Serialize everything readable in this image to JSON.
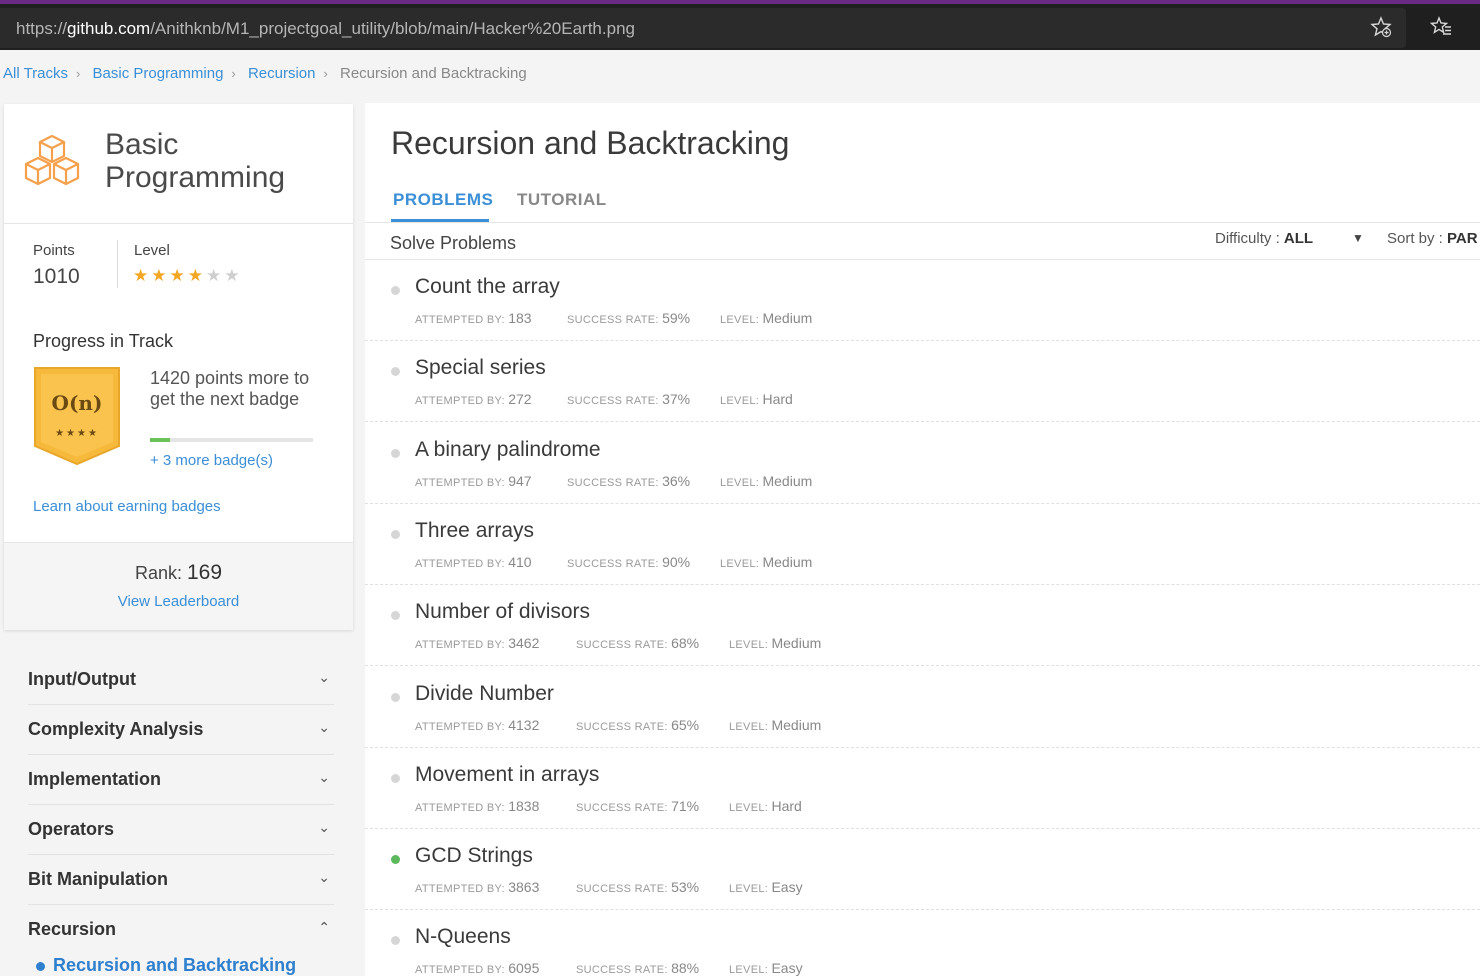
{
  "browser": {
    "url_prefix": "https://",
    "url_domain": "github.com",
    "url_path": "/Anithknb/M1_projectgoal_utility/blob/main/Hacker%20Earth.png"
  },
  "breadcrumb": [
    "All Tracks",
    "Basic Programming",
    "Recursion",
    "Recursion and Backtracking"
  ],
  "track": {
    "title": "Basic Programming",
    "points_label": "Points",
    "points": "1010",
    "level_label": "Level",
    "level_stars": 4,
    "level_max": 6,
    "progress_title": "Progress in Track",
    "badge_text": "O(n)",
    "badge_stars": "★★★★",
    "next_badge_text": "1420 points more to get the next badge",
    "progress_fraction": 0.12,
    "more_badges": "+ 3 more badge(s)",
    "learn_link": "Learn about earning badges",
    "rank_label": "Rank:",
    "rank": "169",
    "leaderboard_link": "View Leaderboard"
  },
  "nav": {
    "items": [
      {
        "label": "Input/Output",
        "expanded": false
      },
      {
        "label": "Complexity Analysis",
        "expanded": false
      },
      {
        "label": "Implementation",
        "expanded": false
      },
      {
        "label": "Operators",
        "expanded": false
      },
      {
        "label": "Bit Manipulation",
        "expanded": false
      },
      {
        "label": "Recursion",
        "expanded": true
      }
    ],
    "active_subitem": "Recursion and Backtracking"
  },
  "main": {
    "title": "Recursion and Backtracking",
    "tabs": [
      "PROBLEMS",
      "TUTORIAL"
    ],
    "solve_label": "Solve Problems",
    "difficulty_label": "Difficulty :",
    "difficulty_value": "ALL",
    "sort_label": "Sort by :",
    "sort_value": "PAR",
    "meta_labels": {
      "attempted": "ATTEMPTED BY:",
      "success": "SUCCESS RATE:",
      "level": "LEVEL:"
    },
    "problems": [
      {
        "name": "Count the array",
        "attempted": "183",
        "success": "59%",
        "level": "Medium",
        "solved": false
      },
      {
        "name": "Special series",
        "attempted": "272",
        "success": "37%",
        "level": "Hard",
        "solved": false
      },
      {
        "name": "A binary palindrome",
        "attempted": "947",
        "success": "36%",
        "level": "Medium",
        "solved": false
      },
      {
        "name": "Three arrays",
        "attempted": "410",
        "success": "90%",
        "level": "Medium",
        "solved": false
      },
      {
        "name": "Number of divisors",
        "attempted": "3462",
        "success": "68%",
        "level": "Medium",
        "solved": false
      },
      {
        "name": "Divide Number",
        "attempted": "4132",
        "success": "65%",
        "level": "Medium",
        "solved": false
      },
      {
        "name": "Movement in arrays",
        "attempted": "1838",
        "success": "71%",
        "level": "Hard",
        "solved": false
      },
      {
        "name": "GCD Strings",
        "attempted": "3863",
        "success": "53%",
        "level": "Easy",
        "solved": true
      },
      {
        "name": "N-Queens",
        "attempted": "6095",
        "success": "88%",
        "level": "Easy",
        "solved": false
      }
    ]
  },
  "colors": {
    "accent": "#3b8fd6",
    "solved": "#5cb85c",
    "star": "#f5a623",
    "badge": "#f6b93b"
  }
}
